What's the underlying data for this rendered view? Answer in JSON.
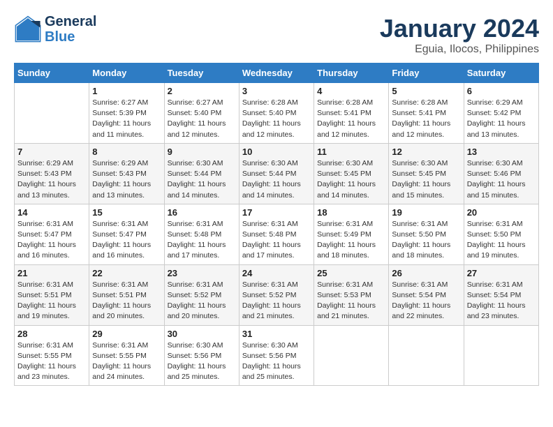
{
  "logo": {
    "line1": "General",
    "line2": "Blue"
  },
  "title": "January 2024",
  "subtitle": "Eguia, Ilocos, Philippines",
  "days_of_week": [
    "Sunday",
    "Monday",
    "Tuesday",
    "Wednesday",
    "Thursday",
    "Friday",
    "Saturday"
  ],
  "weeks": [
    [
      {
        "day": "",
        "info": ""
      },
      {
        "day": "1",
        "info": "Sunrise: 6:27 AM\nSunset: 5:39 PM\nDaylight: 11 hours\nand 11 minutes."
      },
      {
        "day": "2",
        "info": "Sunrise: 6:27 AM\nSunset: 5:40 PM\nDaylight: 11 hours\nand 12 minutes."
      },
      {
        "day": "3",
        "info": "Sunrise: 6:28 AM\nSunset: 5:40 PM\nDaylight: 11 hours\nand 12 minutes."
      },
      {
        "day": "4",
        "info": "Sunrise: 6:28 AM\nSunset: 5:41 PM\nDaylight: 11 hours\nand 12 minutes."
      },
      {
        "day": "5",
        "info": "Sunrise: 6:28 AM\nSunset: 5:41 PM\nDaylight: 11 hours\nand 12 minutes."
      },
      {
        "day": "6",
        "info": "Sunrise: 6:29 AM\nSunset: 5:42 PM\nDaylight: 11 hours\nand 13 minutes."
      }
    ],
    [
      {
        "day": "7",
        "info": "Sunrise: 6:29 AM\nSunset: 5:43 PM\nDaylight: 11 hours\nand 13 minutes."
      },
      {
        "day": "8",
        "info": "Sunrise: 6:29 AM\nSunset: 5:43 PM\nDaylight: 11 hours\nand 13 minutes."
      },
      {
        "day": "9",
        "info": "Sunrise: 6:30 AM\nSunset: 5:44 PM\nDaylight: 11 hours\nand 14 minutes."
      },
      {
        "day": "10",
        "info": "Sunrise: 6:30 AM\nSunset: 5:44 PM\nDaylight: 11 hours\nand 14 minutes."
      },
      {
        "day": "11",
        "info": "Sunrise: 6:30 AM\nSunset: 5:45 PM\nDaylight: 11 hours\nand 14 minutes."
      },
      {
        "day": "12",
        "info": "Sunrise: 6:30 AM\nSunset: 5:45 PM\nDaylight: 11 hours\nand 15 minutes."
      },
      {
        "day": "13",
        "info": "Sunrise: 6:30 AM\nSunset: 5:46 PM\nDaylight: 11 hours\nand 15 minutes."
      }
    ],
    [
      {
        "day": "14",
        "info": "Sunrise: 6:31 AM\nSunset: 5:47 PM\nDaylight: 11 hours\nand 16 minutes."
      },
      {
        "day": "15",
        "info": "Sunrise: 6:31 AM\nSunset: 5:47 PM\nDaylight: 11 hours\nand 16 minutes."
      },
      {
        "day": "16",
        "info": "Sunrise: 6:31 AM\nSunset: 5:48 PM\nDaylight: 11 hours\nand 17 minutes."
      },
      {
        "day": "17",
        "info": "Sunrise: 6:31 AM\nSunset: 5:48 PM\nDaylight: 11 hours\nand 17 minutes."
      },
      {
        "day": "18",
        "info": "Sunrise: 6:31 AM\nSunset: 5:49 PM\nDaylight: 11 hours\nand 18 minutes."
      },
      {
        "day": "19",
        "info": "Sunrise: 6:31 AM\nSunset: 5:50 PM\nDaylight: 11 hours\nand 18 minutes."
      },
      {
        "day": "20",
        "info": "Sunrise: 6:31 AM\nSunset: 5:50 PM\nDaylight: 11 hours\nand 19 minutes."
      }
    ],
    [
      {
        "day": "21",
        "info": "Sunrise: 6:31 AM\nSunset: 5:51 PM\nDaylight: 11 hours\nand 19 minutes."
      },
      {
        "day": "22",
        "info": "Sunrise: 6:31 AM\nSunset: 5:51 PM\nDaylight: 11 hours\nand 20 minutes."
      },
      {
        "day": "23",
        "info": "Sunrise: 6:31 AM\nSunset: 5:52 PM\nDaylight: 11 hours\nand 20 minutes."
      },
      {
        "day": "24",
        "info": "Sunrise: 6:31 AM\nSunset: 5:52 PM\nDaylight: 11 hours\nand 21 minutes."
      },
      {
        "day": "25",
        "info": "Sunrise: 6:31 AM\nSunset: 5:53 PM\nDaylight: 11 hours\nand 21 minutes."
      },
      {
        "day": "26",
        "info": "Sunrise: 6:31 AM\nSunset: 5:54 PM\nDaylight: 11 hours\nand 22 minutes."
      },
      {
        "day": "27",
        "info": "Sunrise: 6:31 AM\nSunset: 5:54 PM\nDaylight: 11 hours\nand 23 minutes."
      }
    ],
    [
      {
        "day": "28",
        "info": "Sunrise: 6:31 AM\nSunset: 5:55 PM\nDaylight: 11 hours\nand 23 minutes."
      },
      {
        "day": "29",
        "info": "Sunrise: 6:31 AM\nSunset: 5:55 PM\nDaylight: 11 hours\nand 24 minutes."
      },
      {
        "day": "30",
        "info": "Sunrise: 6:30 AM\nSunset: 5:56 PM\nDaylight: 11 hours\nand 25 minutes."
      },
      {
        "day": "31",
        "info": "Sunrise: 6:30 AM\nSunset: 5:56 PM\nDaylight: 11 hours\nand 25 minutes."
      },
      {
        "day": "",
        "info": ""
      },
      {
        "day": "",
        "info": ""
      },
      {
        "day": "",
        "info": ""
      }
    ]
  ]
}
